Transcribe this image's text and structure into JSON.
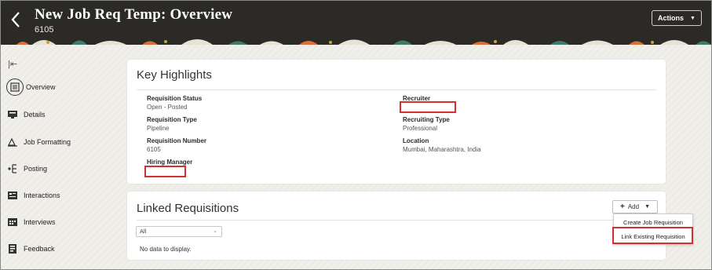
{
  "header": {
    "title": "New Job Req Temp: Overview",
    "subtitle": "6105",
    "actions_label": "Actions",
    "background": "#2c2a26"
  },
  "nav": {
    "items": [
      {
        "label": "Overview",
        "icon": "overview-icon",
        "active": true
      },
      {
        "label": "Details",
        "icon": "details-icon"
      },
      {
        "label": "Job Formatting",
        "icon": "job-formatting-icon"
      },
      {
        "label": "Posting",
        "icon": "posting-icon"
      },
      {
        "label": "Interactions",
        "icon": "interactions-icon"
      },
      {
        "label": "Interviews",
        "icon": "interviews-icon"
      },
      {
        "label": "Feedback",
        "icon": "feedback-icon"
      }
    ]
  },
  "highlights": {
    "title": "Key Highlights",
    "fields": {
      "requisition_status": {
        "label": "Requisition Status",
        "value": "Open - Posted"
      },
      "requisition_type": {
        "label": "Requisition Type",
        "value": "Pipeline"
      },
      "requisition_number": {
        "label": "Requisition Number",
        "value": "6105"
      },
      "hiring_manager": {
        "label": "Hiring Manager",
        "value": ""
      },
      "recruiter": {
        "label": "Recruiter",
        "value": ""
      },
      "recruiting_type": {
        "label": "Recruiting Type",
        "value": "Professional"
      },
      "location": {
        "label": "Location",
        "value": "Mumbai, Maharashtra, India"
      }
    }
  },
  "linked": {
    "title": "Linked Requisitions",
    "add_label": "Add",
    "filter_value": "All",
    "empty_text": "No data to display.",
    "menu": [
      "Create Job Requisition",
      "Link Existing Requisition"
    ]
  },
  "colors": {
    "highlight": "#d32f2f"
  }
}
